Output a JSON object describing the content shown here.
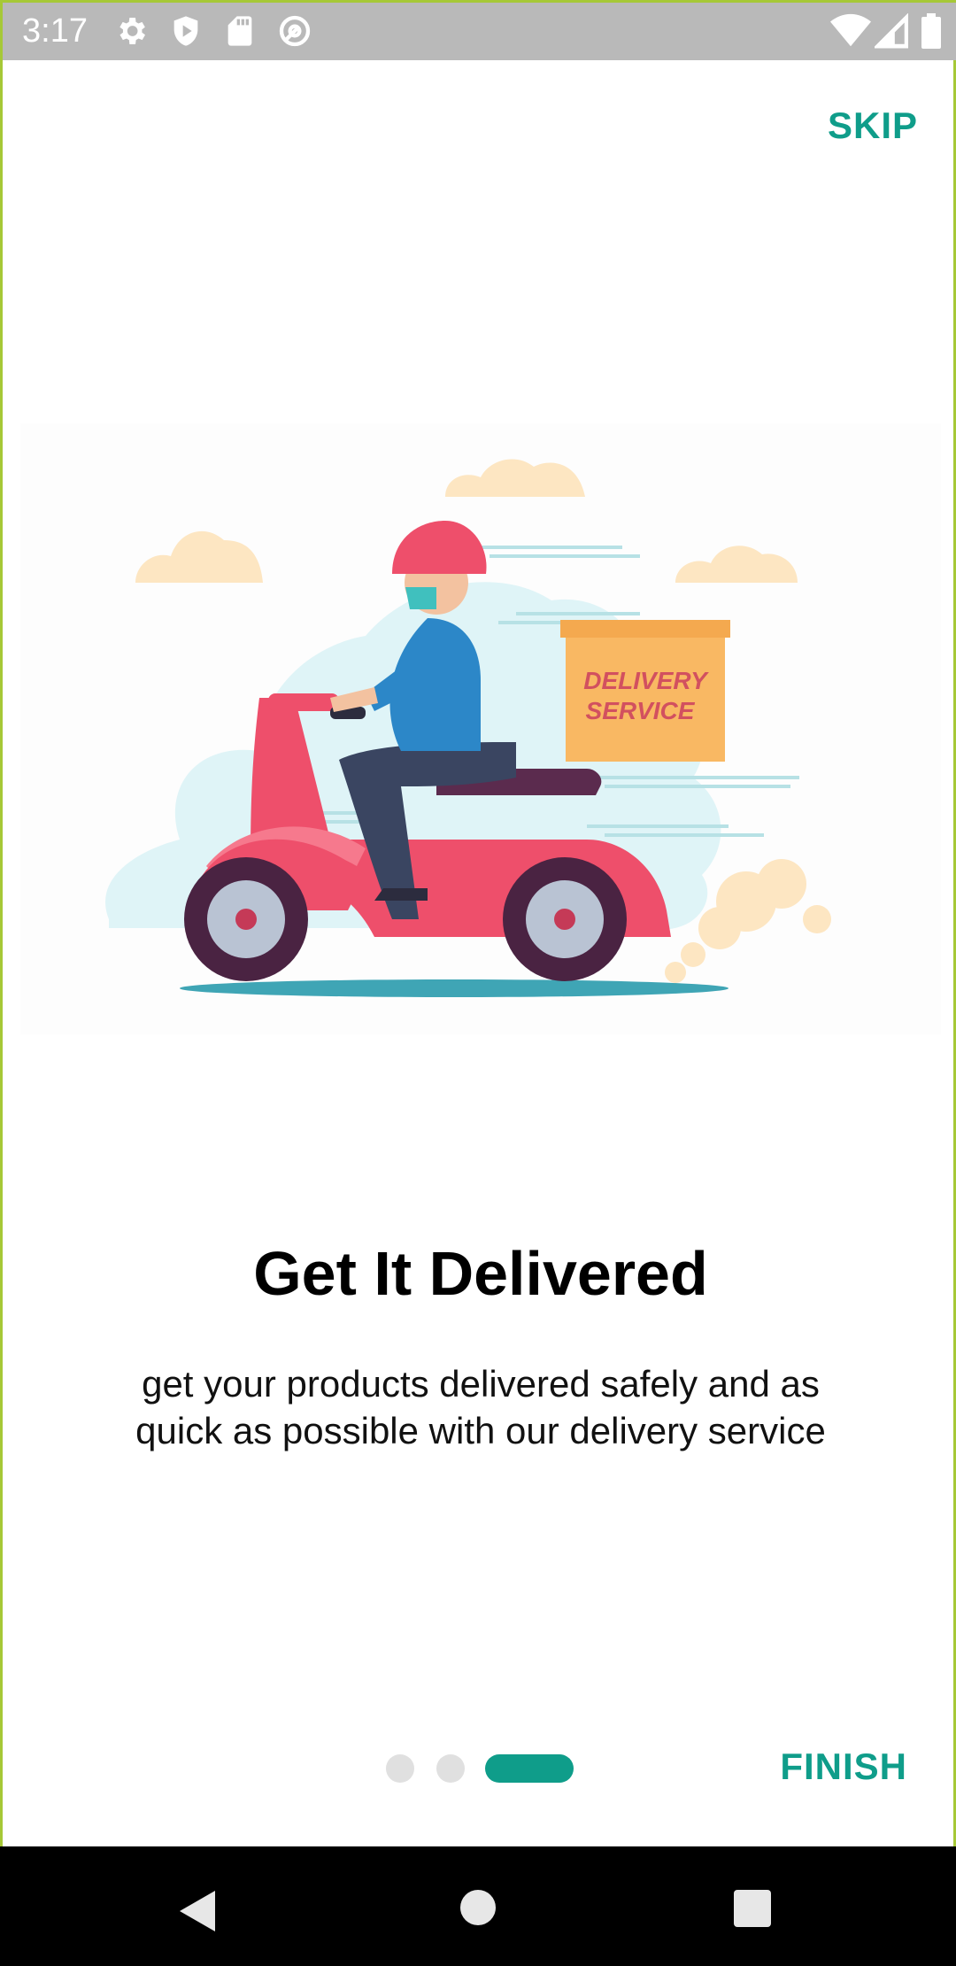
{
  "status_bar": {
    "time": "3:17",
    "left_icons": [
      "gear-icon",
      "play-protect-icon",
      "sd-card-icon",
      "at-sign-icon"
    ],
    "right_icons": [
      "wifi-icon",
      "signal-icon",
      "battery-icon"
    ]
  },
  "onboarding": {
    "skip_label": "SKIP",
    "illustration": {
      "box_text_line1": "DELIVERY",
      "box_text_line2": "SERVICE"
    },
    "title": "Get It Delivered",
    "subtitle": "get your products delivered safely and as quick as possible with our delivery service",
    "page_count": 3,
    "current_page": 3,
    "finish_label": "FINISH"
  },
  "colors": {
    "accent": "#0f9d8a",
    "status_bar": "#b9b9b9",
    "inactive_dot": "#e0e0e0"
  },
  "nav_bar": {
    "buttons": [
      "back-icon",
      "home-icon",
      "recents-icon"
    ]
  }
}
